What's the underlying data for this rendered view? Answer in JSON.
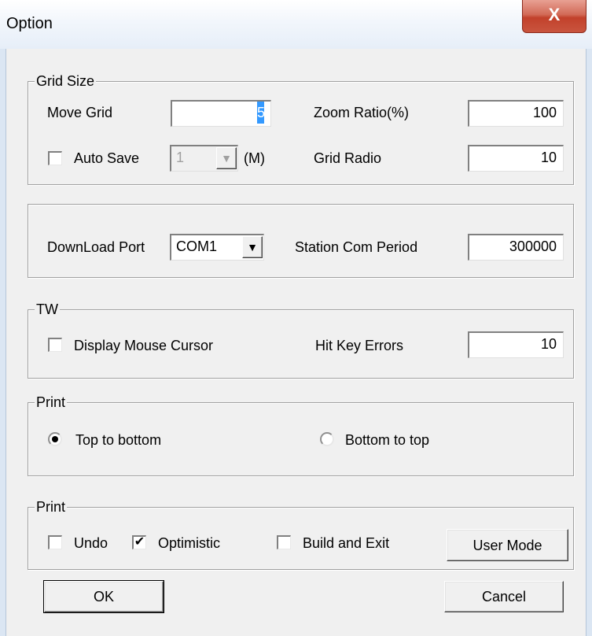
{
  "window": {
    "title": "Option",
    "close_glyph": "X"
  },
  "grid_size": {
    "title": "Grid Size",
    "move_grid_label": "Move Grid",
    "move_grid_value": "5",
    "zoom_ratio_label": "Zoom Ratio(%)",
    "zoom_ratio_value": "100",
    "auto_save_label": "Auto Save",
    "auto_save_checked": false,
    "auto_save_interval": "1",
    "auto_save_unit": "(M)",
    "grid_radio_label": "Grid Radio",
    "grid_radio_value": "10"
  },
  "port": {
    "download_port_label": "DownLoad Port",
    "download_port_value": "COM1",
    "station_com_period_label": "Station Com Period",
    "station_com_period_value": "300000"
  },
  "tw": {
    "title": "TW",
    "display_mouse_cursor_label": "Display Mouse Cursor",
    "display_mouse_cursor_checked": false,
    "hit_key_errors_label": "Hit Key Errors",
    "hit_key_errors_value": "10"
  },
  "print_order": {
    "title": "Print",
    "top_to_bottom_label": "Top to bottom",
    "bottom_to_top_label": "Bottom to top",
    "selected": "top_to_bottom"
  },
  "print_options": {
    "title": "Print",
    "undo_label": "Undo",
    "undo_checked": false,
    "optimistic_label": "Optimistic",
    "optimistic_checked": true,
    "build_and_exit_label": "Build and Exit",
    "build_and_exit_checked": false,
    "user_mode_label": "User Mode"
  },
  "buttons": {
    "ok_label": "OK",
    "cancel_label": "Cancel"
  },
  "glyphs": {
    "check_mark": "✔",
    "dropdown_arrow": "▼"
  },
  "colors": {
    "selection": "#3399ff",
    "close_button": "#c9553f",
    "dialog_bg": "#f0f0f0"
  }
}
